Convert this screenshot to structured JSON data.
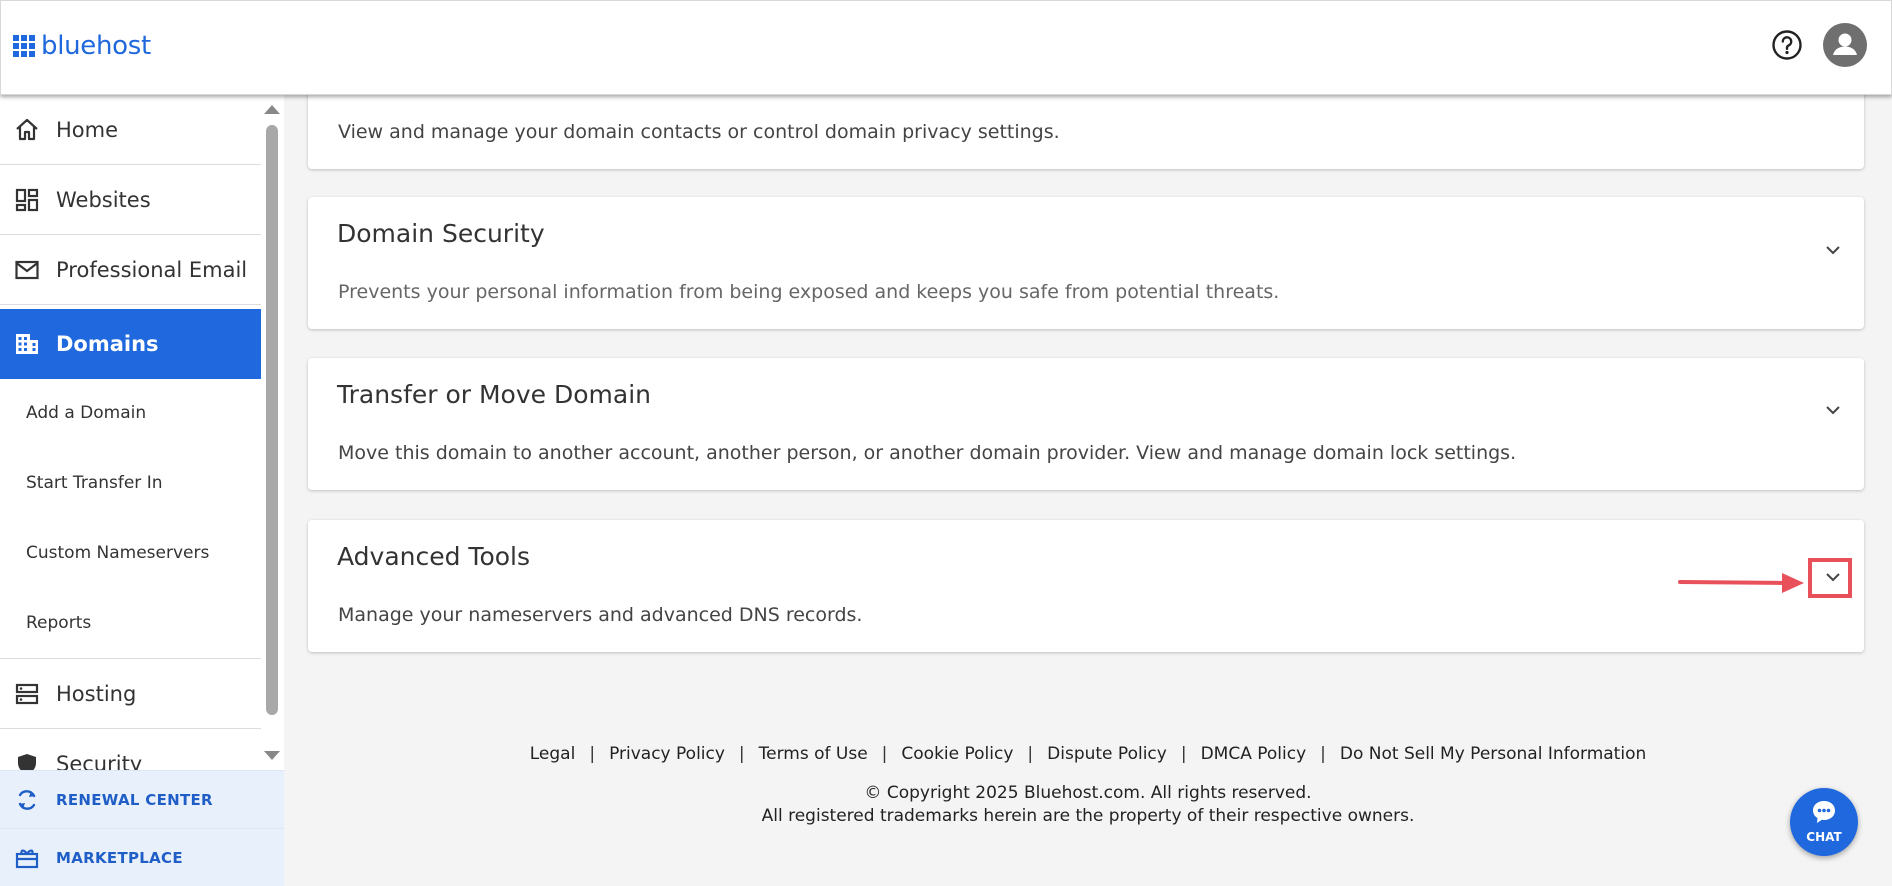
{
  "header": {
    "logo_text": "bluehost",
    "help_icon": "question-circle-icon",
    "avatar_icon": "user-icon"
  },
  "sidebar": {
    "items": [
      {
        "label": "Home",
        "icon": "home-icon"
      },
      {
        "label": "Websites",
        "icon": "dashboard-icon"
      },
      {
        "label": "Professional Email",
        "icon": "mail-icon"
      },
      {
        "label": "Domains",
        "icon": "domains-icon",
        "active": true
      },
      {
        "label": "Hosting",
        "icon": "server-icon"
      },
      {
        "label": "Security",
        "icon": "shield-icon"
      }
    ],
    "sub_items": [
      "Add a Domain",
      "Start Transfer In",
      "Custom Nameservers",
      "Reports"
    ],
    "bottom": [
      {
        "label": "RENEWAL CENTER",
        "icon": "refresh-icon"
      },
      {
        "label": "MARKETPLACE",
        "icon": "gift-icon"
      }
    ]
  },
  "main": {
    "cards": [
      {
        "title": "",
        "desc": "View and manage your domain contacts or control domain privacy settings."
      },
      {
        "title": "Domain Security",
        "desc": "Prevents your personal information from being exposed and keeps you safe from potential threats."
      },
      {
        "title": "Transfer or Move Domain",
        "desc": "Move this domain to another account, another person, or another domain provider. View and manage domain lock settings."
      },
      {
        "title": "Advanced Tools",
        "desc": "Manage your nameservers and advanced DNS records."
      }
    ]
  },
  "footer": {
    "links": [
      "Legal",
      "Privacy Policy",
      "Terms of Use",
      "Cookie Policy",
      "Dispute Policy",
      "DMCA Policy",
      "Do Not Sell My Personal Information"
    ],
    "copyright": "© Copyright 2025 Bluehost.com. All rights reserved.",
    "trademark": "All registered trademarks herein are the property of their respective owners."
  },
  "chat": {
    "label": "CHAT",
    "icon": "chat-bubble-icon"
  },
  "colors": {
    "brand": "#1f68dd",
    "highlight": "#e8515a"
  }
}
